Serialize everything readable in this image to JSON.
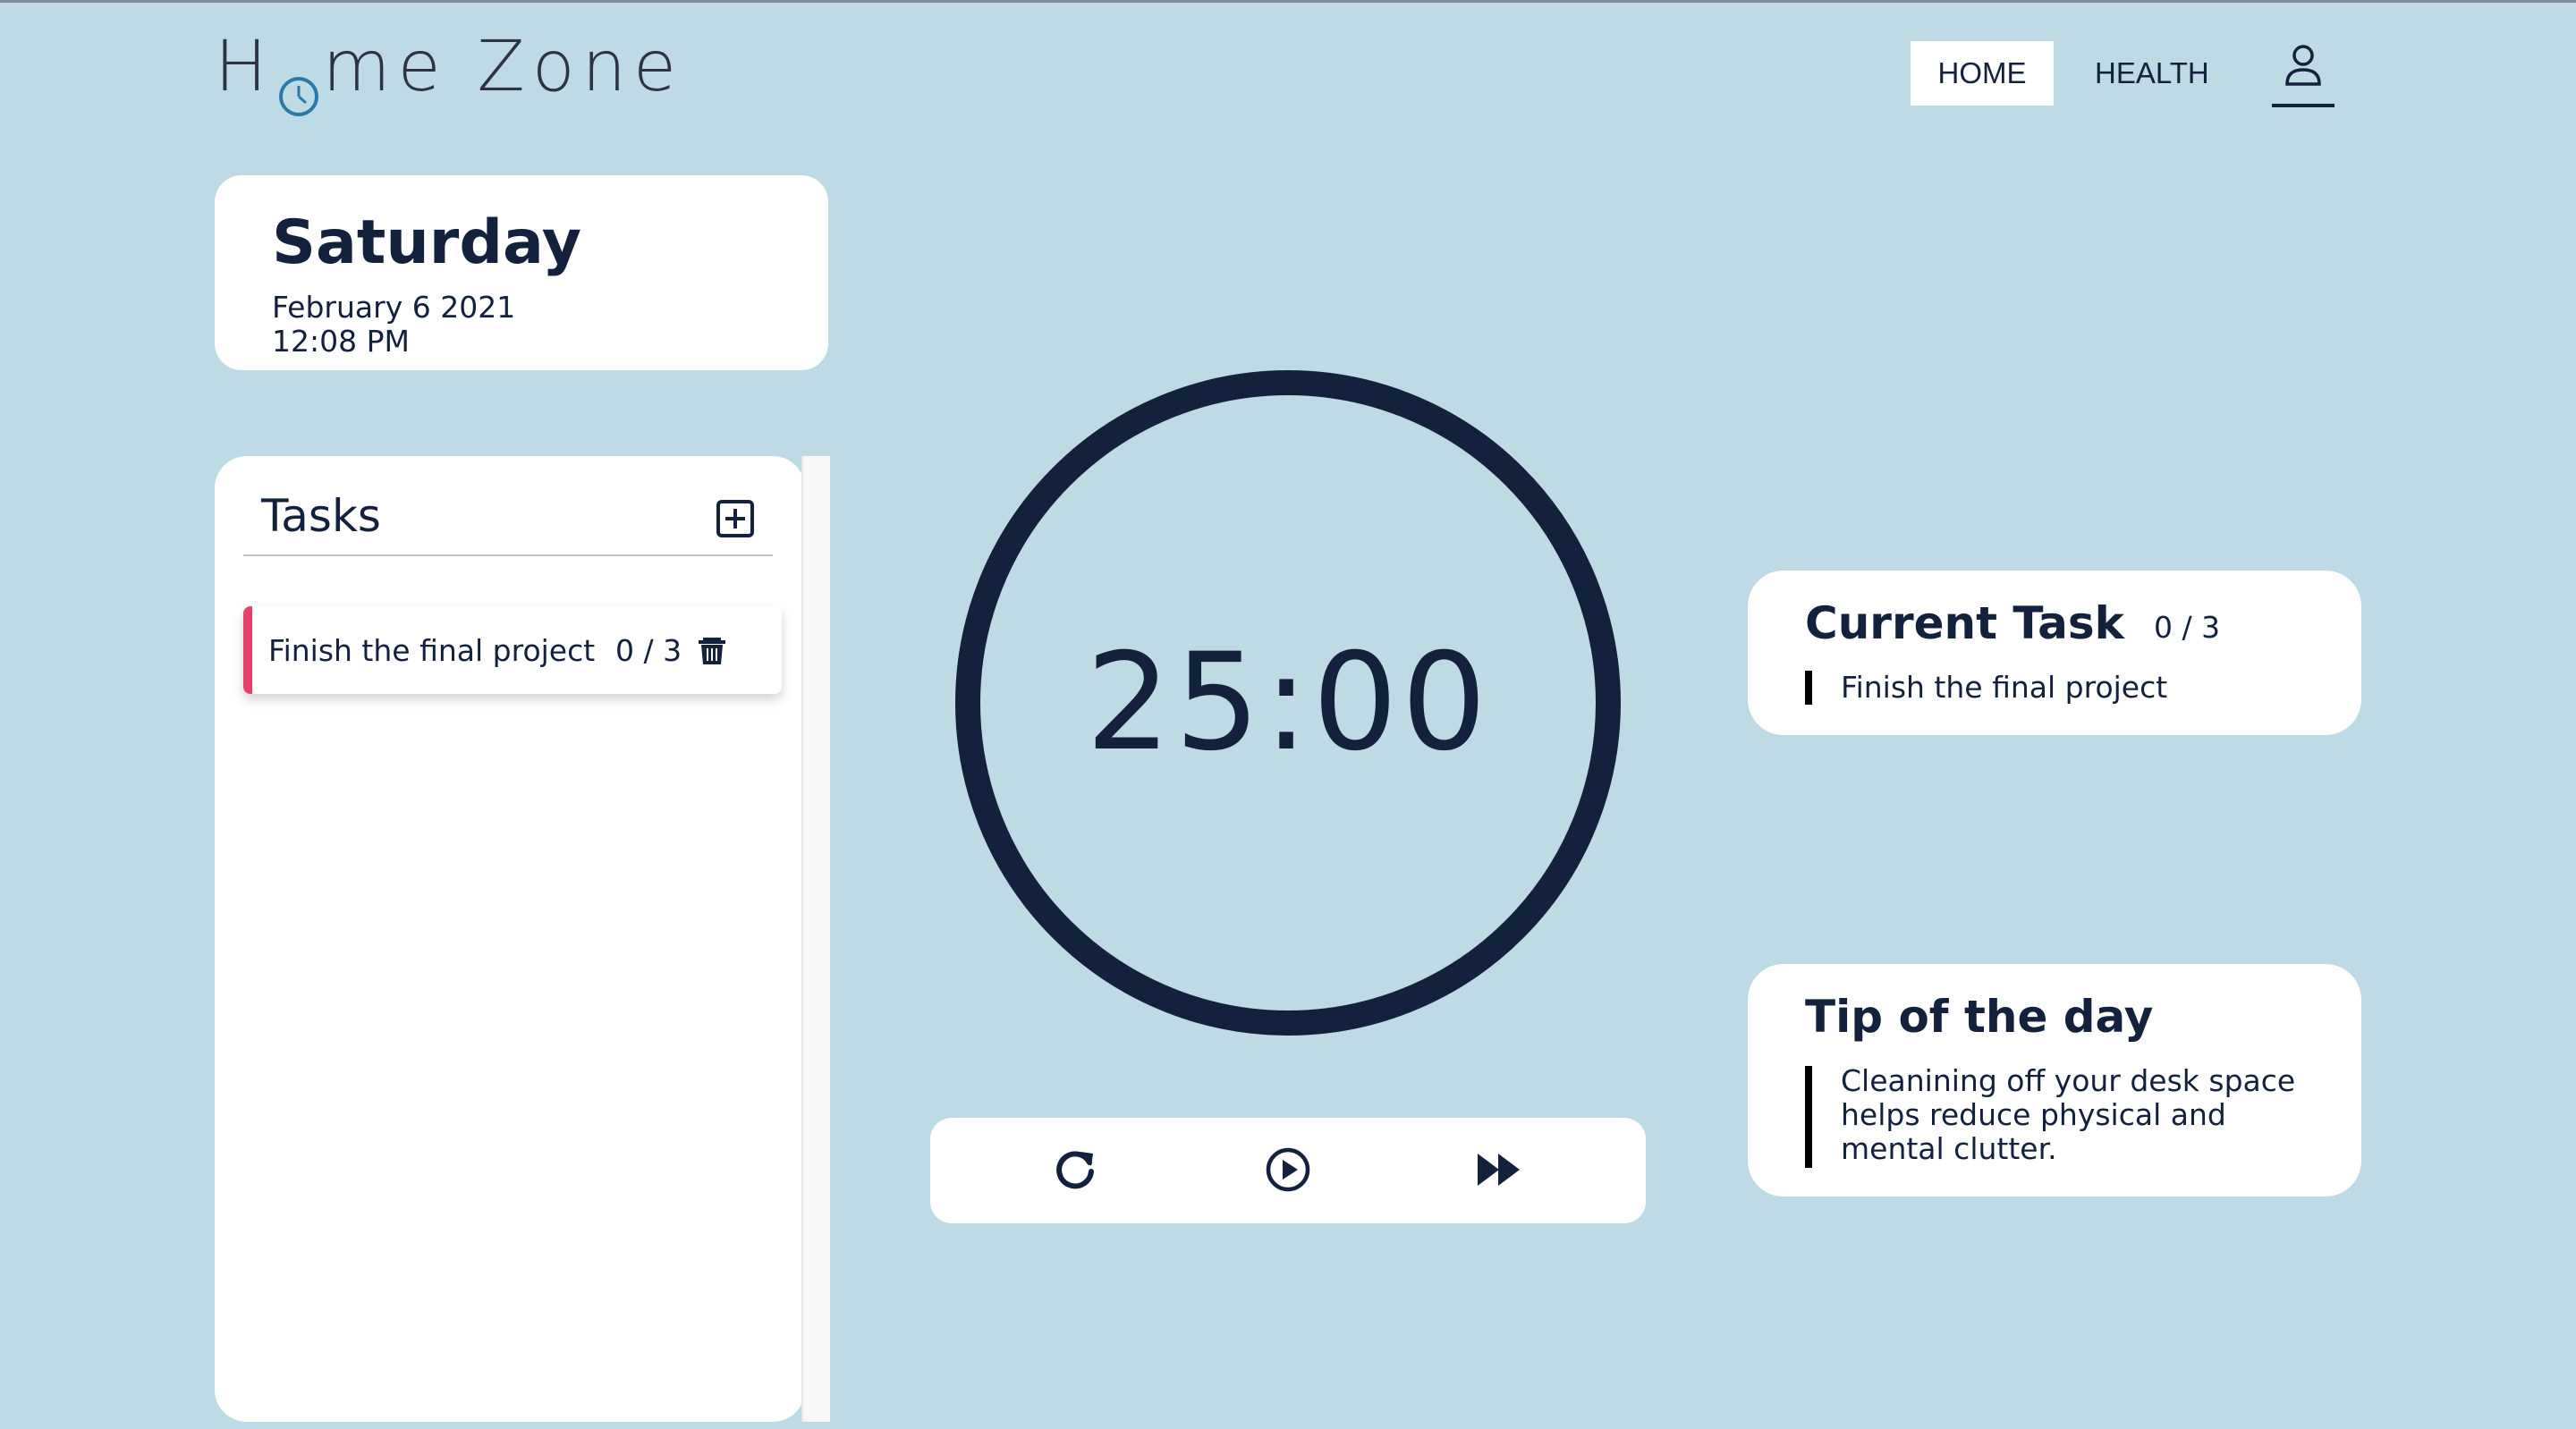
{
  "header": {
    "logo_left": "H",
    "logo_right": "me Zone",
    "nav": {
      "home": "HOME",
      "health": "HEALTH"
    },
    "icons": {
      "logo_clock": "clock-icon",
      "user": "user-icon"
    }
  },
  "date_card": {
    "day": "Saturday",
    "date": "February 6 2021",
    "time": "12:08 PM"
  },
  "tasks": {
    "title": "Tasks",
    "items": [
      {
        "label": "Finish the final project",
        "count": "0 / 3"
      }
    ],
    "icons": {
      "add": "plus-square-icon",
      "delete": "trash-icon"
    },
    "accent_color": "#e64269"
  },
  "timer": {
    "display": "25:00",
    "controls": {
      "reset": "refresh-icon",
      "play": "play-circle-icon",
      "skip": "fast-forward-icon"
    }
  },
  "current_task": {
    "title": "Current Task",
    "count": "0 / 3",
    "task": "Finish the final project"
  },
  "tip": {
    "title": "Tip of the day",
    "lines": [
      "Cleanining off your desk space",
      "helps reduce physical and",
      "mental clutter."
    ]
  },
  "colors": {
    "background": "#bedbe5",
    "text": "#13213d",
    "card": "#ffffff"
  }
}
